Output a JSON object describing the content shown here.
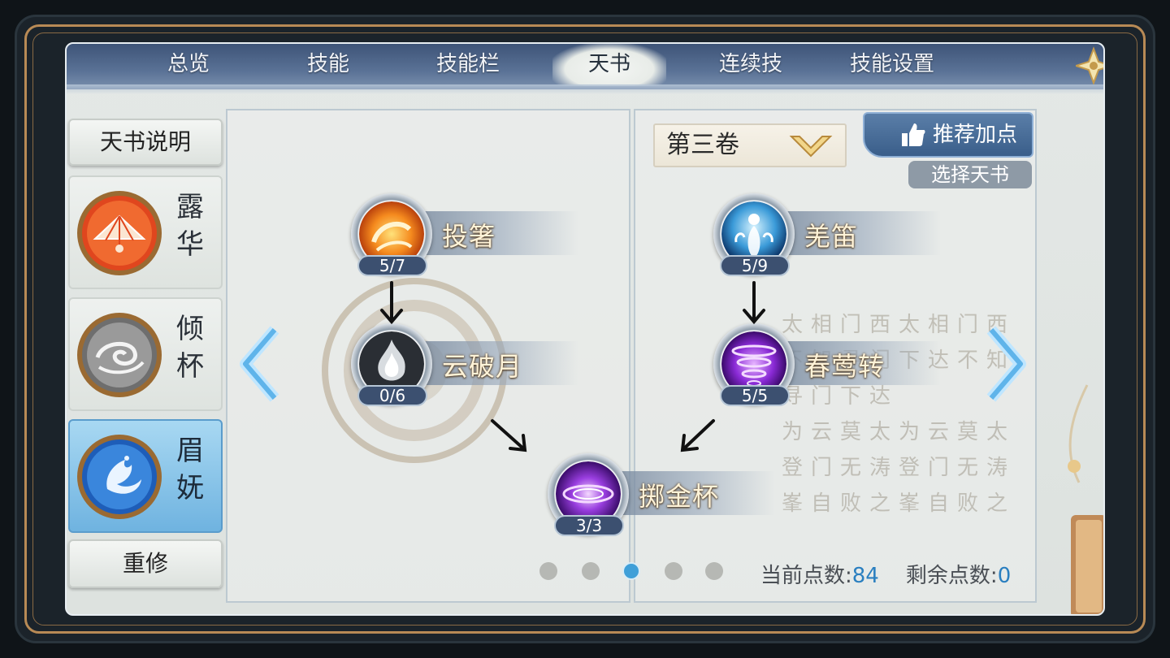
{
  "tabs": [
    "总览",
    "技能",
    "技能栏",
    "天书",
    "连续技",
    "技能设置"
  ],
  "active_tab": "天书",
  "side": {
    "help_label": "天书说明",
    "schools": [
      {
        "name_1": "露",
        "name_2": "华",
        "active": false
      },
      {
        "name_1": "倾",
        "name_2": "杯",
        "active": false
      },
      {
        "name_1": "眉",
        "name_2": "妩",
        "active": true
      }
    ],
    "reset_label": "重修"
  },
  "volume": {
    "label": "第三卷"
  },
  "buttons": {
    "recommend": "推荐加点",
    "select_book": "选择天书"
  },
  "skills_left": [
    {
      "name": "投箸",
      "level": "5/7",
      "icon": "fire-swirl-icon"
    },
    {
      "name": "云破月",
      "level": "0/6",
      "icon": "white-flame-icon"
    },
    {
      "name": "掷金杯",
      "level": "3/3",
      "icon": "purple-vortex-icon"
    }
  ],
  "skills_right": [
    {
      "name": "羌笛",
      "level": "5/9",
      "icon": "blue-spirit-icon"
    },
    {
      "name": "春莺转",
      "level": "5/5",
      "icon": "purple-tornado-icon"
    }
  ],
  "pagination": {
    "count": 5,
    "active_index": 2
  },
  "points": {
    "current_label": "当前点数:",
    "current": "84",
    "remaining_label": "剩余点数:",
    "remaining": "0"
  },
  "calligraphy": [
    "太相门西太相门西",
    "不知寻门下达不知寻门下达",
    "为云莫太为云莫太",
    "登门无涛登门无涛",
    "峯自败之峯自败之"
  ],
  "colors": {
    "accent": "#3f9fd8",
    "tab_bar": "#4a6288",
    "gold_frame": "#b88a55"
  }
}
